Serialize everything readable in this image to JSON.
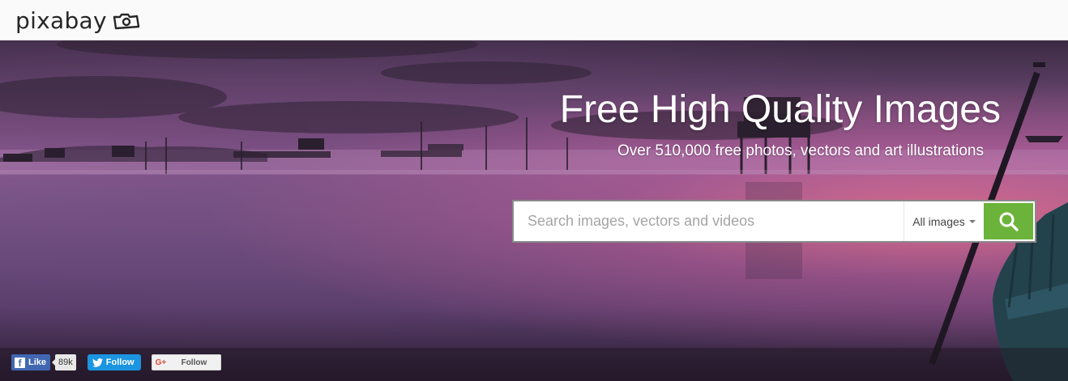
{
  "app": {
    "logo_text": "pixabay"
  },
  "hero": {
    "title": "Free High Quality Images",
    "subtitle": "Over 510,000 free photos, vectors and art illustrations"
  },
  "search": {
    "placeholder": "Search images, vectors and videos",
    "value": "",
    "filter_label": "All images",
    "button_icon": "search-icon"
  },
  "social": {
    "facebook_like_label": "Like",
    "facebook_like_count": "89k",
    "twitter_follow_label": "Follow",
    "google_plus_icon_text": "G+",
    "google_plus_follow_label": "Follow"
  },
  "colors": {
    "accent_green": "#6bb33a",
    "facebook_blue": "#4267b2",
    "twitter_blue": "#1b95e0"
  }
}
